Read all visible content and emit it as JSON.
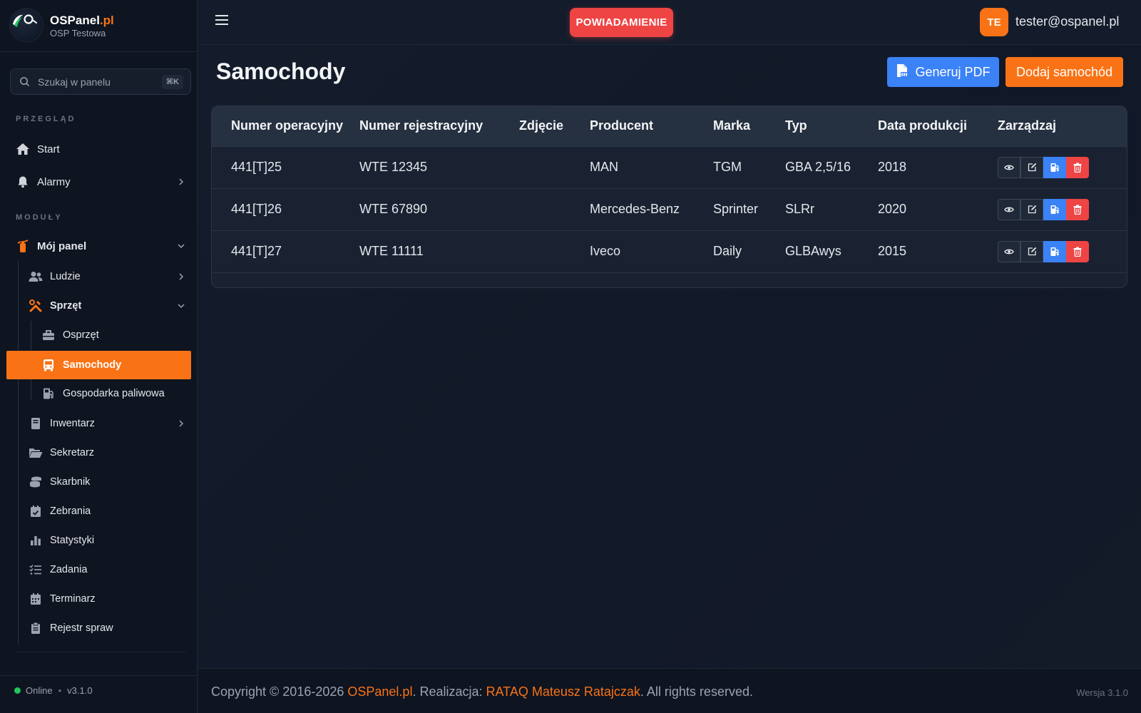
{
  "brand": {
    "name": "OSPanel",
    "tld": ".pl",
    "subtitle": "OSP Testowa"
  },
  "search": {
    "placeholder": "Szukaj w panelu",
    "shortcut": "⌘K"
  },
  "sections": {
    "overview": "PRZEGLĄD",
    "modules": "MODUŁY"
  },
  "nav": {
    "start": "Start",
    "alarms": "Alarmy",
    "my_panel": "Mój panel",
    "people": "Ludzie",
    "equipment": "Sprzęt",
    "gear": "Osprzęt",
    "cars": "Samochody",
    "fuel": "Gospodarka paliwowa",
    "inventory": "Inwentarz",
    "secretary": "Sekretarz",
    "treasurer": "Skarbnik",
    "meetings": "Zebrania",
    "stats": "Statystyki",
    "tasks": "Zadania",
    "schedule": "Terminarz",
    "register": "Rejestr spraw"
  },
  "sidebar_status": {
    "state": "Online",
    "sep": "•",
    "version": "v3.1.0"
  },
  "topbar": {
    "notify_label": "POWIADAMIENIE",
    "avatar_initials": "TE",
    "user_email": "tester@ospanel.pl"
  },
  "page": {
    "title": "Samochody",
    "pdf_label": "Generuj PDF",
    "add_label": "Dodaj samochód"
  },
  "table": {
    "headers": [
      "Numer operacyjny",
      "Numer rejestracyjny",
      "Zdjęcie",
      "Producent",
      "Marka",
      "Typ",
      "Data produkcji",
      "Zarządzaj"
    ],
    "rows": [
      {
        "op": "441[T]25",
        "reg": "WTE 12345",
        "photo": "",
        "producer": "MAN",
        "brand": "TGM",
        "type": "GBA 2,5/16",
        "year": "2018"
      },
      {
        "op": "441[T]26",
        "reg": "WTE 67890",
        "photo": "",
        "producer": "Mercedes-Benz",
        "brand": "Sprinter",
        "type": "SLRr",
        "year": "2020"
      },
      {
        "op": "441[T]27",
        "reg": "WTE 11111",
        "photo": "",
        "producer": "Iveco",
        "brand": "Daily",
        "type": "GLBAwys",
        "year": "2015"
      }
    ]
  },
  "footer": {
    "copy_prefix": "Copyright © 2016-2026 ",
    "copy_brand": "OSPanel.pl",
    "copy_mid": ". Realizacja: ",
    "copy_author": "RATAQ Mateusz Ratajczak",
    "copy_suffix": ". All rights reserved.",
    "version": "Wersja 3.1.0"
  },
  "colors": {
    "accent": "#f97316",
    "primary": "#3b82f6",
    "danger": "#ef4444",
    "online": "#22c55e"
  }
}
